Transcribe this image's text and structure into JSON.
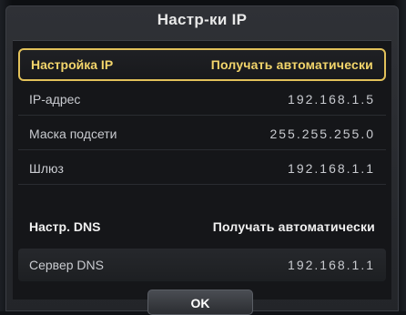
{
  "dialog": {
    "title": "Настр-ки IP",
    "ip_settings": {
      "label": "Настройка IP",
      "value": "Получать автоматически"
    },
    "ip_address": {
      "label": "IP-адрес",
      "value": "192.168.1.5"
    },
    "subnet_mask": {
      "label": "Маска подсети",
      "value": "255.255.255.0"
    },
    "gateway": {
      "label": "Шлюз",
      "value": "192.168.1.1"
    },
    "dns_settings": {
      "label": "Настр. DNS",
      "value": "Получать автоматически"
    },
    "dns_server": {
      "label": "Сервер DNS",
      "value": "192.168.1.1"
    },
    "ok_label": "OK"
  },
  "colors": {
    "highlight": "#e2c15a",
    "background": "#151619",
    "text": "#c9cbd0"
  }
}
